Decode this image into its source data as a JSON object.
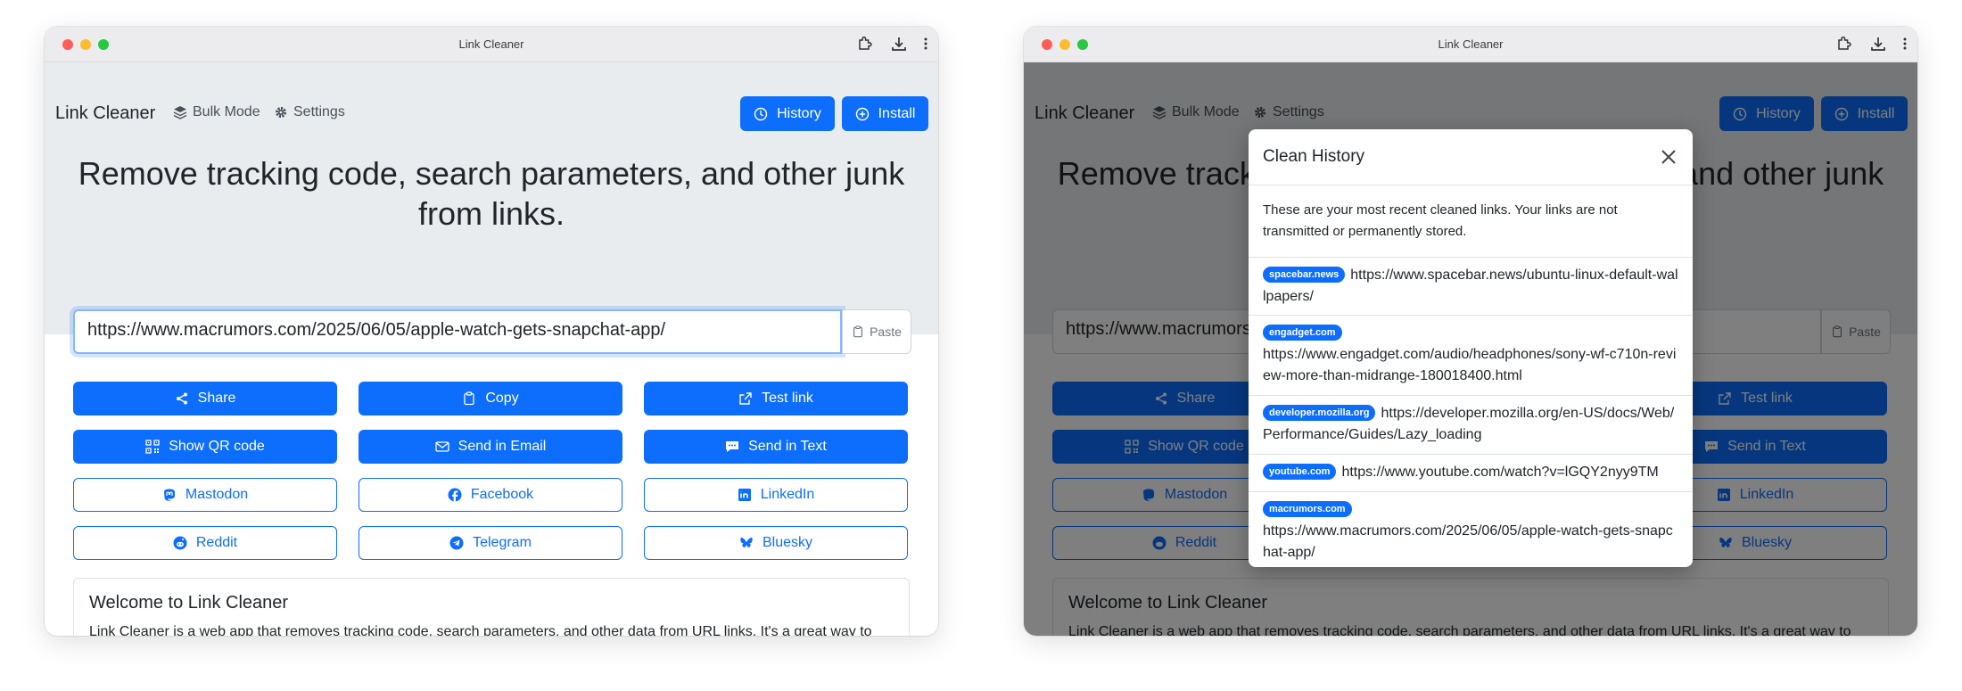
{
  "window": {
    "title": "Link Cleaner",
    "toolbar_icons": [
      "extensions-icon",
      "download-icon",
      "more-vert-icon"
    ]
  },
  "nav": {
    "brand": "Link Cleaner",
    "bulk_mode": "Bulk Mode",
    "settings": "Settings",
    "history_button": "History",
    "install_button": "Install"
  },
  "hero": {
    "headline": "Remove tracking code, search parameters, and other junk from links.",
    "url_value": "https://www.macrumors.com/2025/06/05/apple-watch-gets-snapchat-app/",
    "paste_button": "Paste"
  },
  "actions": {
    "primary": [
      {
        "label": "Share",
        "icon": "share-icon"
      },
      {
        "label": "Copy",
        "icon": "clipboard-icon"
      },
      {
        "label": "Test link",
        "icon": "external-link-icon"
      },
      {
        "label": "Show QR code",
        "icon": "qr-code-icon"
      },
      {
        "label": "Send in Email",
        "icon": "envelope-icon"
      },
      {
        "label": "Send in Text",
        "icon": "chat-icon"
      }
    ],
    "outline": [
      {
        "label": "Mastodon",
        "icon": "mastodon-icon"
      },
      {
        "label": "Facebook",
        "icon": "facebook-icon"
      },
      {
        "label": "LinkedIn",
        "icon": "linkedin-icon"
      },
      {
        "label": "Reddit",
        "icon": "reddit-icon"
      },
      {
        "label": "Telegram",
        "icon": "telegram-icon"
      },
      {
        "label": "Bluesky",
        "icon": "bluesky-icon"
      }
    ]
  },
  "welcome": {
    "title": "Welcome to Link Cleaner",
    "text": "Link Cleaner is a web app that removes tracking code, search parameters, and other data from URL links. It's a great way to"
  },
  "history_modal": {
    "title": "Clean History",
    "intro": "These are your most recent cleaned links. Your links are not transmitted or permanently stored.",
    "items": [
      {
        "domain": "spacebar.news",
        "url": "https://www.spacebar.news/ubuntu-linux-default-wallpapers/"
      },
      {
        "domain": "engadget.com",
        "url": "https://www.engadget.com/audio/headphones/sony-wf-c710n-review-more-than-midrange-180018400.html"
      },
      {
        "domain": "developer.mozilla.org",
        "url": "https://developer.mozilla.org/en-US/docs/Web/Performance/Guides/Lazy_loading"
      },
      {
        "domain": "youtube.com",
        "url": "https://www.youtube.com/watch?v=lGQY2nyy9TM"
      },
      {
        "domain": "macrumors.com",
        "url": "https://www.macrumors.com/2025/06/05/apple-watch-gets-snapchat-app/"
      }
    ]
  },
  "colors": {
    "primary": "#0d6efd",
    "hero_bg": "#e9ecef",
    "overlay": "rgba(0,0,0,0.5)"
  }
}
